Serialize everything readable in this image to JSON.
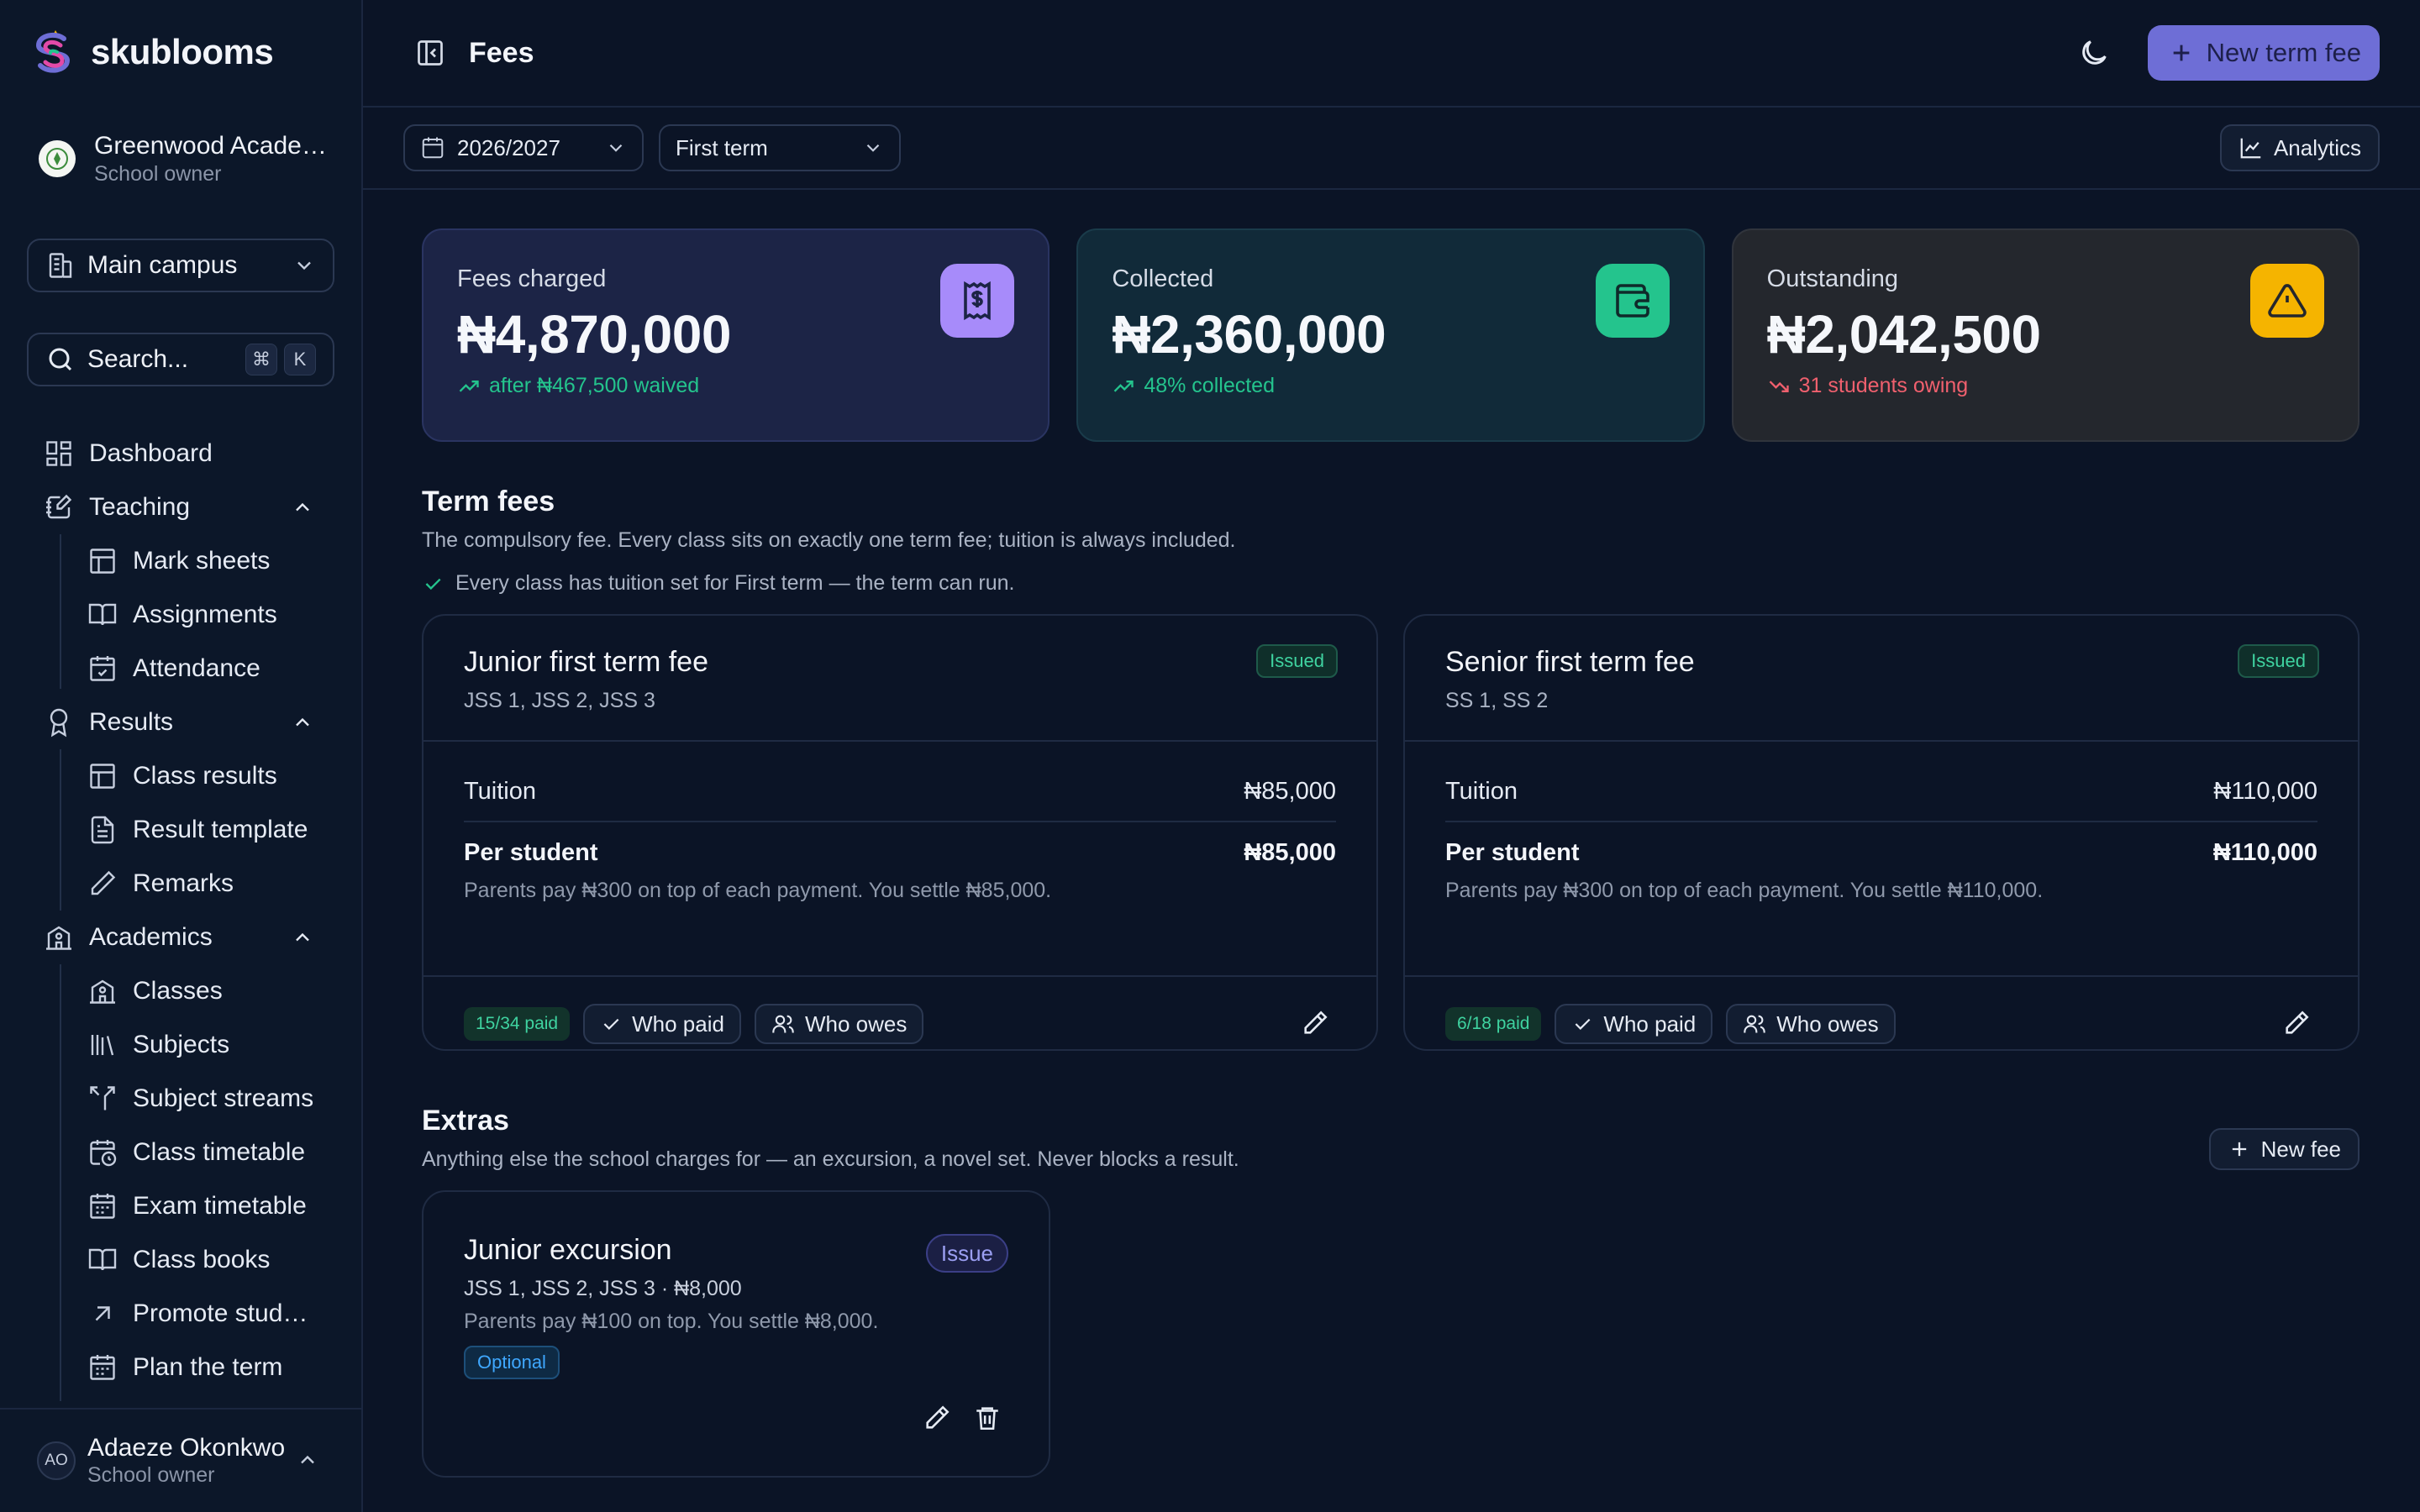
{
  "brand": {
    "name": "skublooms"
  },
  "school": {
    "name": "Greenwood Academy",
    "role": "School owner"
  },
  "campus": {
    "selected": "Main campus"
  },
  "search": {
    "placeholder": "Search...",
    "kbd1": "⌘",
    "kbd2": "K"
  },
  "nav": {
    "dashboard": "Dashboard",
    "teaching": "Teaching",
    "mark_sheets": "Mark sheets",
    "assignments": "Assignments",
    "attendance": "Attendance",
    "results": "Results",
    "class_results": "Class results",
    "result_template": "Result template",
    "remarks": "Remarks",
    "academics": "Academics",
    "classes": "Classes",
    "subjects": "Subjects",
    "subject_streams": "Subject streams",
    "class_timetable": "Class timetable",
    "exam_timetable": "Exam timetable",
    "class_books": "Class books",
    "promote_students": "Promote students",
    "plan_term": "Plan the term"
  },
  "user": {
    "initials": "AO",
    "name": "Adaeze Okonkwo",
    "role": "School owner"
  },
  "header": {
    "title": "Fees",
    "new_term_fee": "New term fee"
  },
  "filters": {
    "session": "2026/2027",
    "term": "First term",
    "analytics": "Analytics"
  },
  "stats": {
    "charged": {
      "label": "Fees charged",
      "value": "₦4,870,000",
      "sub": "after ₦467,500 waived"
    },
    "collected": {
      "label": "Collected",
      "value": "₦2,360,000",
      "sub": "48% collected"
    },
    "outstanding": {
      "label": "Outstanding",
      "value": "₦2,042,500",
      "sub": "31 students owing"
    }
  },
  "colors": {
    "accent": "#6e6ed6",
    "success": "#24c48d",
    "warning": "#f5b400",
    "danger": "#f0606e",
    "purple_tile": "#a78bfa"
  },
  "term_fees": {
    "title": "Term fees",
    "description": "The compulsory fee. Every class sits on exactly one term fee; tuition is always included.",
    "check_note": "Every class has tuition set for First term — the term can run.",
    "cards": [
      {
        "title": "Junior first term fee",
        "classes": "JSS 1, JSS 2, JSS 3",
        "status": "Issued",
        "tuition_label": "Tuition",
        "tuition": "₦85,000",
        "per_student_label": "Per student",
        "per_student": "₦85,000",
        "note": "Parents pay ₦300 on top of each payment. You settle ₦85,000.",
        "paid": "15/34 paid",
        "who_paid": "Who paid",
        "who_owes": "Who owes"
      },
      {
        "title": "Senior first term fee",
        "classes": "SS 1, SS 2",
        "status": "Issued",
        "tuition_label": "Tuition",
        "tuition": "₦110,000",
        "per_student_label": "Per student",
        "per_student": "₦110,000",
        "note": "Parents pay ₦300 on top of each payment. You settle ₦110,000.",
        "paid": "6/18 paid",
        "who_paid": "Who paid",
        "who_owes": "Who owes"
      }
    ]
  },
  "extras": {
    "title": "Extras",
    "description": "Anything else the school charges for — an excursion, a novel set. Never blocks a result.",
    "new_fee": "New fee",
    "cards": [
      {
        "title": "Junior excursion",
        "meta": "JSS 1, JSS 2, JSS 3 · ₦8,000",
        "note": "Parents pay ₦100 on top. You settle ₦8,000.",
        "tag": "Optional",
        "action": "Issue"
      }
    ]
  }
}
